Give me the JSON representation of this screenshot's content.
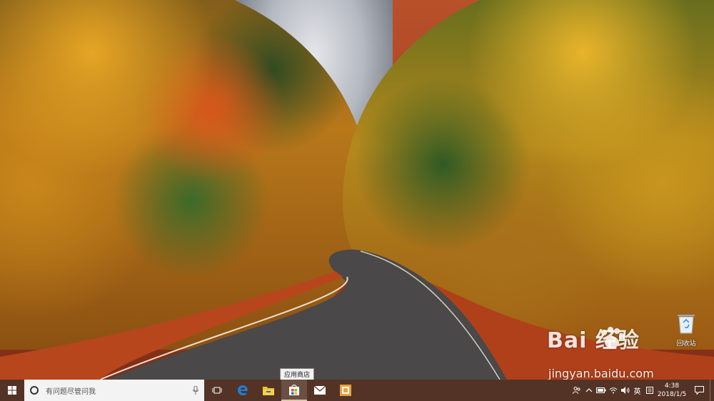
{
  "desktop": {
    "watermark": {
      "brand": "Bai 经验",
      "url": "jingyan.baidu.com"
    },
    "recycle_bin": {
      "label": "回收站"
    },
    "tooltip": "应用商店"
  },
  "taskbar": {
    "search_placeholder": "有问题尽管问我",
    "apps": [
      {
        "name": "task-view",
        "icon": "task-view-icon"
      },
      {
        "name": "edge",
        "icon": "edge-icon"
      },
      {
        "name": "file-explorer",
        "icon": "folder-icon"
      },
      {
        "name": "store",
        "icon": "store-icon",
        "active": true
      },
      {
        "name": "mail",
        "icon": "mail-icon"
      },
      {
        "name": "office",
        "icon": "office-icon"
      }
    ],
    "tray": {
      "input_lang": "英",
      "time": "4:38",
      "date": "2018/1/5"
    }
  },
  "colors": {
    "taskbar": "#46241a",
    "search_box": "#f3f3f3",
    "edge_blue": "#1d7fd8",
    "folder_yellow": "#f0c030",
    "store_blue": "#1e73c8",
    "office_orange": "#e8a33a"
  }
}
